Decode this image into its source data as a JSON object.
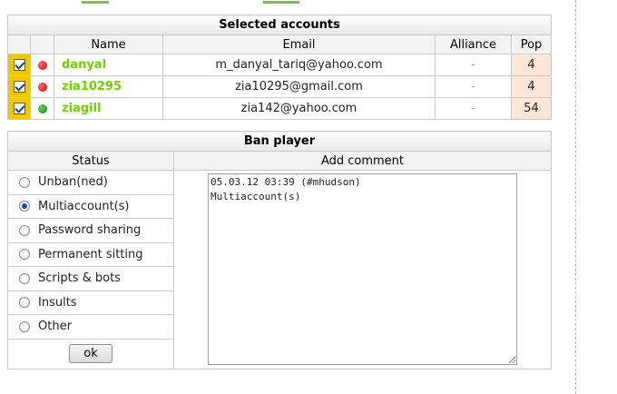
{
  "colors": {
    "accent_green": "#71d000",
    "checkbox_bg": "#f0c800",
    "pop_bg": "#ffe6d6",
    "online_red": "#dd1111",
    "online_green": "#1a9a1a"
  },
  "selected_accounts": {
    "title": "Selected accounts",
    "columns": {
      "name": "Name",
      "email": "Email",
      "alliance": "Alliance",
      "pop": "Pop"
    },
    "rows": [
      {
        "checked": true,
        "status_color": "red",
        "name": "danyal",
        "email": "m_danyal_tariq@yahoo.com",
        "alliance": "-",
        "pop": "4"
      },
      {
        "checked": true,
        "status_color": "red",
        "name": "zia10295",
        "email": "zia10295@gmail.com",
        "alliance": "-",
        "pop": "4"
      },
      {
        "checked": true,
        "status_color": "green",
        "name": "ziagill",
        "email": "zia142@yahoo.com",
        "alliance": "-",
        "pop": "54"
      }
    ]
  },
  "ban_player": {
    "title": "Ban player",
    "status_header": "Status",
    "comment_header": "Add comment",
    "options": [
      {
        "label": "Unban(ned)",
        "checked": false
      },
      {
        "label": "Multiaccount(s)",
        "checked": true
      },
      {
        "label": "Password sharing",
        "checked": false
      },
      {
        "label": "Permanent sitting",
        "checked": false
      },
      {
        "label": "Scripts & bots",
        "checked": false
      },
      {
        "label": "Insults",
        "checked": false
      },
      {
        "label": "Other",
        "checked": false
      }
    ],
    "ok_label": "ok",
    "comment_value": "05.03.12 03:39 (#mhudson)\nMultiaccount(s)"
  }
}
